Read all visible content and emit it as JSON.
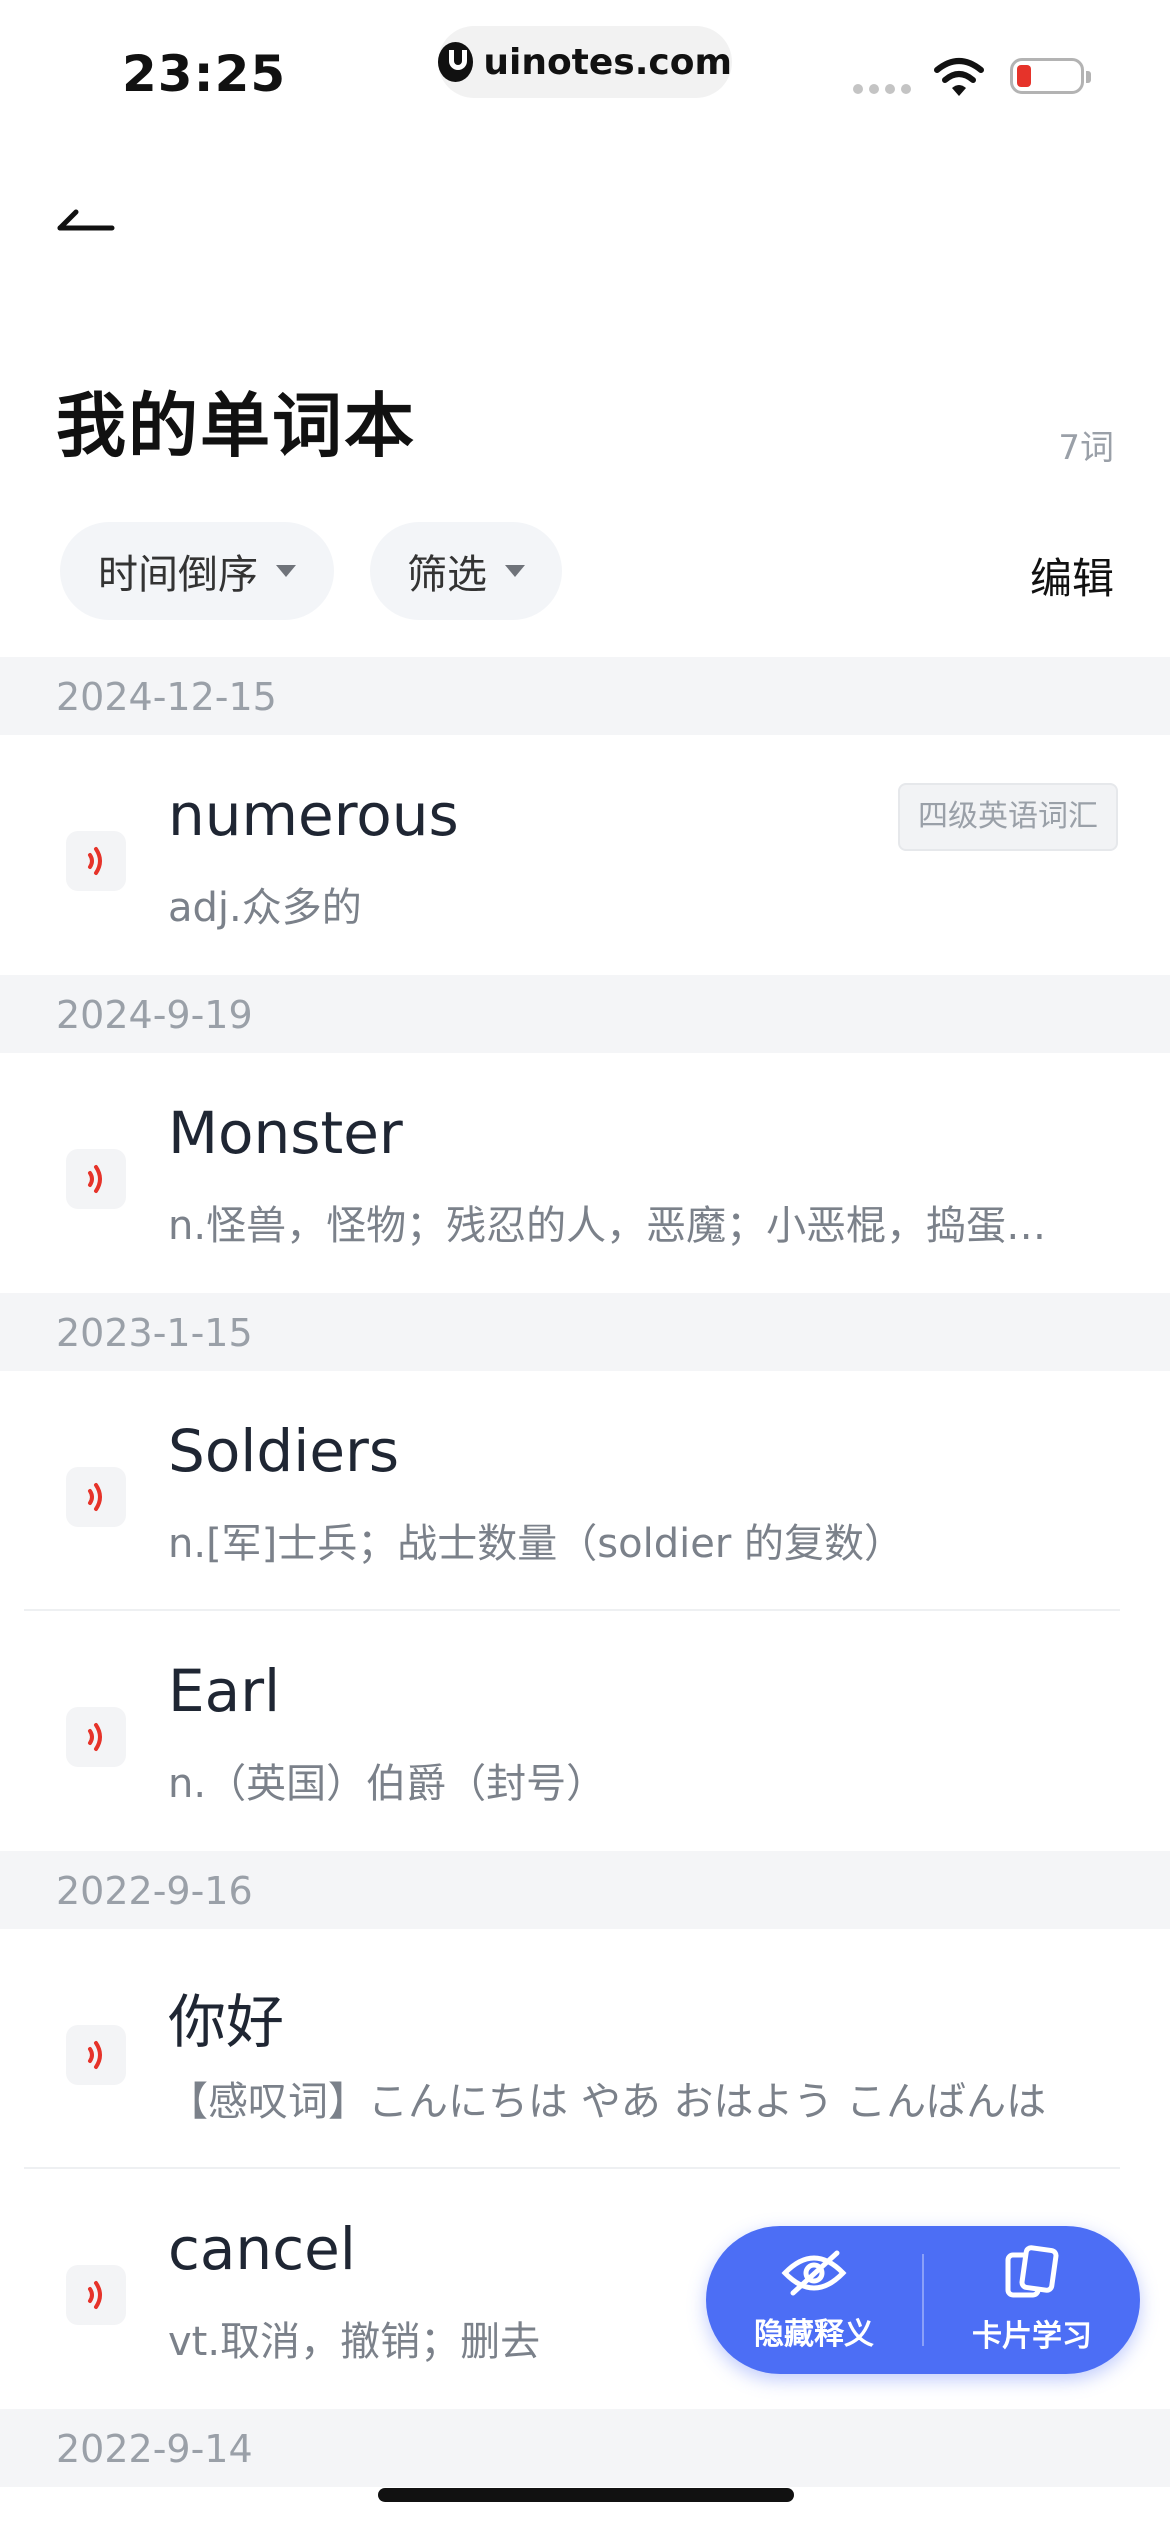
{
  "status_bar": {
    "time": "23:25",
    "url": "uinotes.com"
  },
  "header": {
    "title": "我的单词本",
    "count": "7词"
  },
  "filters": {
    "sort_label": "时间倒序",
    "filter_label": "筛选",
    "edit_label": "编辑"
  },
  "groups": [
    {
      "date": "2024-12-15",
      "words": [
        {
          "word": "numerous",
          "meaning": "adj.众多的",
          "tag": "四级英语词汇"
        }
      ]
    },
    {
      "date": "2024-9-19",
      "words": [
        {
          "word": "Monster",
          "meaning": "n.怪兽，怪物；残忍的人，恶魔；小恶棍，捣蛋…"
        }
      ]
    },
    {
      "date": "2023-1-15",
      "words": [
        {
          "word": "Soldiers",
          "meaning": "n.[军]士兵；战士数量（soldier 的复数）"
        },
        {
          "word": "Earl",
          "meaning": "n.（英国）伯爵（封号）"
        }
      ]
    },
    {
      "date": "2022-9-16",
      "words": [
        {
          "word": "你好",
          "meaning": "【感叹词】こんにちは やあ おはよう こんばんは"
        },
        {
          "word": "cancel",
          "meaning": "vt.取消，撤销；删去"
        }
      ]
    },
    {
      "date": "2022-9-14",
      "words": []
    }
  ],
  "floating_actions": {
    "hide_label": "隐藏释义",
    "card_label": "卡片学习"
  },
  "colors": {
    "accent": "#4c6ef5",
    "speaker": "#e6332a"
  }
}
